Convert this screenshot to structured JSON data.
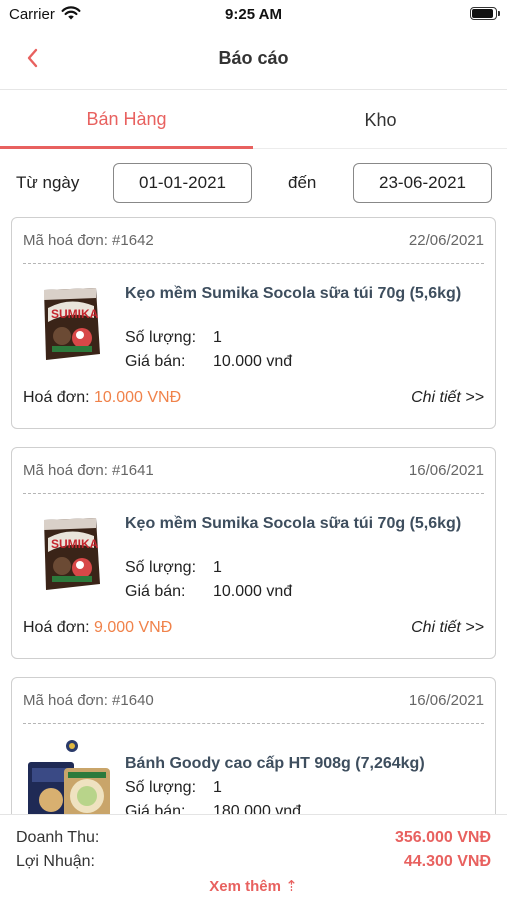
{
  "status_bar": {
    "carrier": "Carrier",
    "time": "9:25 AM"
  },
  "header": {
    "title": "Báo cáo"
  },
  "tabs": [
    {
      "label": "Bán Hàng",
      "active": true
    },
    {
      "label": "Kho",
      "active": false
    }
  ],
  "filter": {
    "from_label": "Từ ngày",
    "from_value": "01-01-2021",
    "to_label": "đến",
    "to_value": "23-06-2021"
  },
  "invoices": [
    {
      "code": "Mã hoá đơn: #1642",
      "date": "22/06/2021",
      "product_name": "Kẹo mềm Sumika Socola sữa túi 70g (5,6kg)",
      "product_icon": "candy-bag-icon",
      "qty_label": "Số lượng:",
      "qty": "1",
      "price_label": "Giá bán:",
      "price": "10.000 vnđ",
      "total_label": "Hoá đơn:",
      "total": "10.000 VNĐ",
      "detail_label": "Chi tiết >>"
    },
    {
      "code": "Mã hoá đơn: #1641",
      "date": "16/06/2021",
      "product_name": "Kẹo mềm Sumika Socola sữa túi 70g (5,6kg)",
      "product_icon": "candy-bag-icon",
      "qty_label": "Số lượng:",
      "qty": "1",
      "price_label": "Giá bán:",
      "price": "10.000 vnđ",
      "total_label": "Hoá đơn:",
      "total": "9.000 VNĐ",
      "detail_label": "Chi tiết >>"
    },
    {
      "code": "Mã hoá đơn: #1640",
      "date": "16/06/2021",
      "product_name": "Bánh Goody cao cấp HT 908g (7,264kg)",
      "product_icon": "cookie-tin-icon",
      "qty_label": "Số lượng:",
      "qty": "1",
      "price_label": "Giá bán:",
      "price": "180.000 vnđ",
      "total_label": "Hoá đơn:",
      "total": "",
      "detail_label": ""
    }
  ],
  "summary": {
    "revenue_label": "Doanh Thu:",
    "revenue_value": "356.000 VNĐ",
    "profit_label": "Lợi Nhuận:",
    "profit_value": "44.300 VNĐ",
    "more_label": "Xem thêm",
    "more_icon": "arrow-up-icon"
  },
  "colors": {
    "accent": "#e8615f",
    "amount": "#f0824a",
    "product_text": "#3e4e5e"
  }
}
